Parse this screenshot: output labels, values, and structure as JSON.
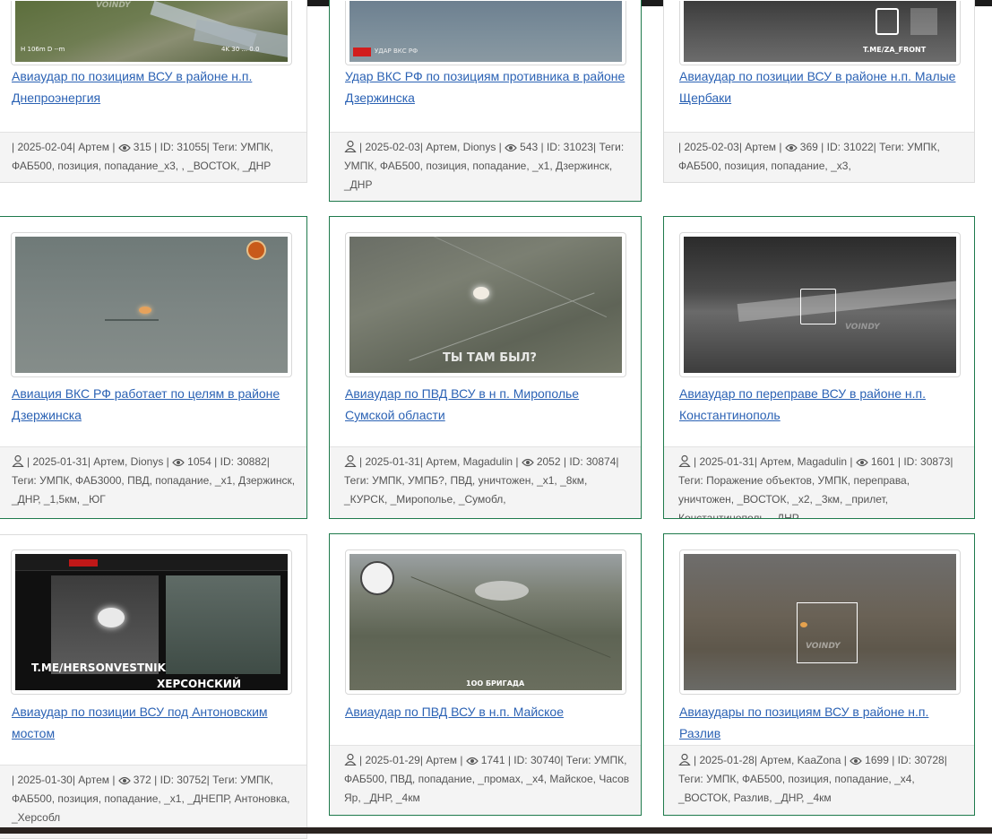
{
  "cards": [
    {
      "title": "Авиаудар по позициям ВСУ в районе н.п. Днепроэнергия",
      "date": "2025-02-04",
      "authors": "Артем",
      "views": "315",
      "id": "31055",
      "tags": "УМПК, ФАБ500, позиция, попадание_x3, , _ВОСТОК, _ДНР",
      "overlay": [
        "H 106m  D --m",
        "4K 30 ... 0.0",
        "VOINDY"
      ]
    },
    {
      "title": "Удар ВКС РФ по позициям противника в районе Дзержинска",
      "date": "2025-02-03",
      "authors": "Артем, Dionys",
      "views": "543",
      "id": "31023",
      "tags": "УМПК, ФАБ500, позиция, попадание, _x1, Дзержинск, _ДНР",
      "overlay": [
        "УДАР ВКС РФ"
      ]
    },
    {
      "title": "Авиаудар по позиции ВСУ в районе н.п. Малые Щербаки",
      "date": "2025-02-03",
      "authors": "Артем",
      "views": "369",
      "id": "31022",
      "tags": "УМПК, ФАБ500, позиция, попадание, _x3,",
      "overlay": [
        "T.ME/ZA_FRONT"
      ]
    },
    {
      "title": "Авиация ВКС РФ работает по целям в районе Дзержинска",
      "date": "2025-01-31",
      "authors": "Артем, Dionys",
      "views": "1054",
      "id": "30882",
      "tags": "УМПК, ФАБ3000, ПВД, попадание, _x1, Дзержинск, _ДНР, _1,5км, _ЮГ",
      "overlay": []
    },
    {
      "title": "Авиаудар по ПВД ВСУ в н п. Миропольe Сумской области",
      "date": "2025-01-31",
      "authors": "Артем, Magadulin ",
      "views": "2052",
      "id": "30874",
      "tags": "УМПК, УМПБ?, ПВД, уничтожен, _x1, _8км, _КУРСК, _Мирополье, _Сумобл,",
      "overlay": [
        "ТЫ ТАМ БЫЛ?"
      ]
    },
    {
      "title": "Авиаудар по переправе ВСУ в районе н.п. Константинополь",
      "date": "2025-01-31",
      "authors": "Артем, Magadulin",
      "views": "1601",
      "id": "30873",
      "tags": "Поражение объектов, УМПК, переправа, уничтожен, _ВОСТОК, _x2, _3км, _прилет, Константинополь, _ДНР",
      "overlay": [
        "VOINDY"
      ]
    },
    {
      "title": "Авиаудар по позиции ВСУ под Антоновским мостом",
      "date": "2025-01-30",
      "authors": "Артем",
      "views": "372",
      "id": "30752",
      "tags": "УМПК, ФАБ500, позиция, попадание, _x1, _ДНЕПР, Антоновка, _Херсобл",
      "overlay": [
        "T.ME/HERSONVESTNIK",
        "ХЕРСОНСКИЙ ВЕСТНИК"
      ]
    },
    {
      "title": "Авиаудар по ПВД ВСУ в н.п. Майское",
      "date": "2025-01-29",
      "authors": "Артем",
      "views": "1741",
      "id": "30740",
      "tags": "УМПК, ФАБ500, ПВД, попадание, _промах, _x4, Майское, Часов Яр, _ДНР, _4км",
      "overlay": [
        "1ОО БРИГАДА"
      ]
    },
    {
      "title": "Авиаудары по позициям ВСУ в районе н.п. Разлив",
      "date": "2025-01-28",
      "authors": "Артем, KaaZona",
      "views": "1699",
      "id": "30728",
      "tags": "УМПК, ФАБ500, позиция, попадание, _x4, _ВОСТОК, Разлив, _ДНР, _4км",
      "overlay": [
        "VOINDY"
      ]
    }
  ],
  "meta_labels": {
    "id_prefix": "ID: ",
    "tags_prefix": "Теги: "
  },
  "colors": {
    "link": "#2b62b4",
    "highlight_border": "#1f7a4c",
    "meta_bg": "#f4f4f4"
  },
  "icons": {
    "author": "person-icon",
    "views": "eye-icon"
  }
}
